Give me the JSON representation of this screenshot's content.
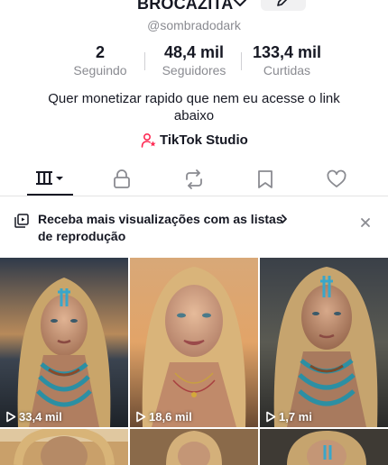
{
  "profile": {
    "display_name": "BROCAZITA",
    "handle": "@sombradodark",
    "bio": "Quer monetizar rapido que nem eu acesse o link abaixo"
  },
  "stats": [
    {
      "value": "2",
      "label": "Seguindo"
    },
    {
      "value": "48,4 mil",
      "label": "Seguidores"
    },
    {
      "value": "133,4 mil",
      "label": "Curtidas"
    }
  ],
  "studio_link": {
    "label": "TikTok Studio",
    "icon": "person-star-icon",
    "accent": "#fe2c55"
  },
  "tabs": [
    {
      "icon": "videos-grid-icon",
      "active": true
    },
    {
      "icon": "lock-icon",
      "active": false
    },
    {
      "icon": "repost-icon",
      "active": false
    },
    {
      "icon": "bookmark-icon",
      "active": false
    },
    {
      "icon": "heart-icon",
      "active": false
    }
  ],
  "promo": {
    "text": "Receba mais visualizações com as listas de reprodução",
    "icon": "playlist-icon"
  },
  "videos": [
    {
      "views": "33,4 mil"
    },
    {
      "views": "18,6 mil"
    },
    {
      "views": "1,7 mi"
    }
  ],
  "colors": {
    "text_primary": "#161823",
    "text_secondary": "#8a8b91",
    "accent": "#fe2c55"
  }
}
